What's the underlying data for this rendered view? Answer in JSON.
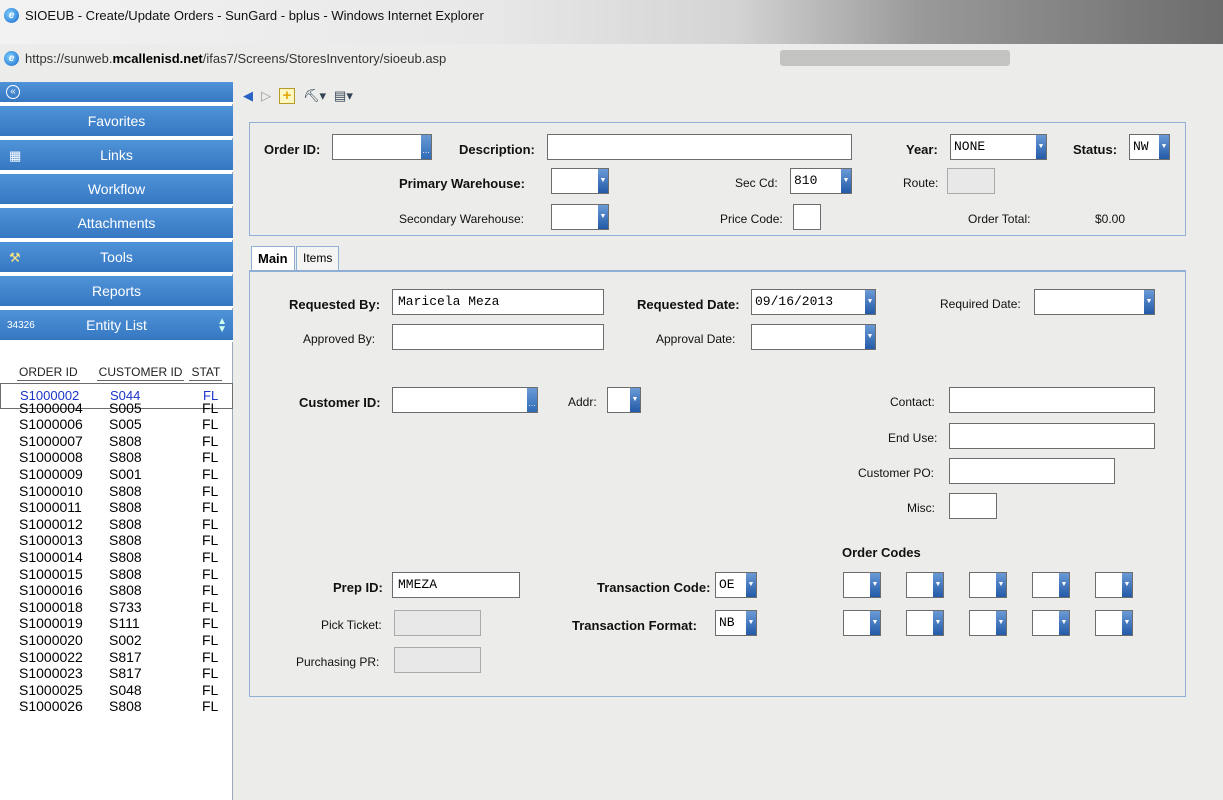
{
  "window": {
    "title": "SIOEUB - Create/Update Orders - SunGard - bplus - Windows Internet Explorer",
    "url_prefix": "https://sunweb.",
    "url_domain": "mcallenisd.net",
    "url_path": "/ifas7/Screens/StoresInventory/sioeub.asp"
  },
  "sidebar": {
    "items": [
      {
        "label": "Favorites"
      },
      {
        "label": "Links"
      },
      {
        "label": "Workflow"
      },
      {
        "label": "Attachments"
      },
      {
        "label": "Tools"
      },
      {
        "label": "Reports"
      },
      {
        "label": "Entity List",
        "count": "34326"
      }
    ],
    "entity_list": {
      "headers": [
        "ORDER ID",
        "CUSTOMER ID",
        "STAT"
      ],
      "rows": [
        [
          "S1000002",
          "S044",
          "FL"
        ],
        [
          "S1000004",
          "S005",
          "FL"
        ],
        [
          "S1000006",
          "S005",
          "FL"
        ],
        [
          "S1000007",
          "S808",
          "FL"
        ],
        [
          "S1000008",
          "S808",
          "FL"
        ],
        [
          "S1000009",
          "S001",
          "FL"
        ],
        [
          "S1000010",
          "S808",
          "FL"
        ],
        [
          "S1000011",
          "S808",
          "FL"
        ],
        [
          "S1000012",
          "S808",
          "FL"
        ],
        [
          "S1000013",
          "S808",
          "FL"
        ],
        [
          "S1000014",
          "S808",
          "FL"
        ],
        [
          "S1000015",
          "S808",
          "FL"
        ],
        [
          "S1000016",
          "S808",
          "FL"
        ],
        [
          "S1000018",
          "S733",
          "FL"
        ],
        [
          "S1000019",
          "S111",
          "FL"
        ],
        [
          "S1000020",
          "S002",
          "FL"
        ],
        [
          "S1000022",
          "S817",
          "FL"
        ],
        [
          "S1000023",
          "S817",
          "FL"
        ],
        [
          "S1000025",
          "S048",
          "FL"
        ],
        [
          "S1000026",
          "S808",
          "FL"
        ]
      ]
    }
  },
  "header_form": {
    "order_id_label": "Order ID:",
    "order_id_value": "",
    "description_label": "Description:",
    "description_value": "",
    "year_label": "Year:",
    "year_value": "NONE",
    "status_label": "Status:",
    "status_value": "NW",
    "primary_wh_label": "Primary Warehouse:",
    "primary_wh_value": "",
    "sec_cd_label": "Sec Cd:",
    "sec_cd_value": "810",
    "route_label": "Route:",
    "secondary_wh_label": "Secondary Warehouse:",
    "secondary_wh_value": "",
    "price_code_label": "Price Code:",
    "order_total_label": "Order Total:",
    "order_total_value": "$0.00"
  },
  "tabs": [
    {
      "label": "Main"
    },
    {
      "label": "Items"
    }
  ],
  "main_form": {
    "requested_by_label": "Requested By:",
    "requested_by_value": "Maricela Meza",
    "requested_date_label": "Requested Date:",
    "requested_date_value": "09/16/2013",
    "required_date_label": "Required Date:",
    "approved_by_label": "Approved By:",
    "approval_date_label": "Approval Date:",
    "customer_id_label": "Customer ID:",
    "addr_label": "Addr:",
    "contact_label": "Contact:",
    "end_use_label": "End Use:",
    "customer_po_label": "Customer PO:",
    "misc_label": "Misc:",
    "order_codes_label": "Order Codes",
    "prep_id_label": "Prep ID:",
    "prep_id_value": "MMEZA",
    "transaction_code_label": "Transaction Code:",
    "transaction_code_value": "OE",
    "pick_ticket_label": "Pick Ticket:",
    "transaction_format_label": "Transaction Format:",
    "transaction_format_value": "NB",
    "purchasing_pr_label": "Purchasing PR:"
  }
}
